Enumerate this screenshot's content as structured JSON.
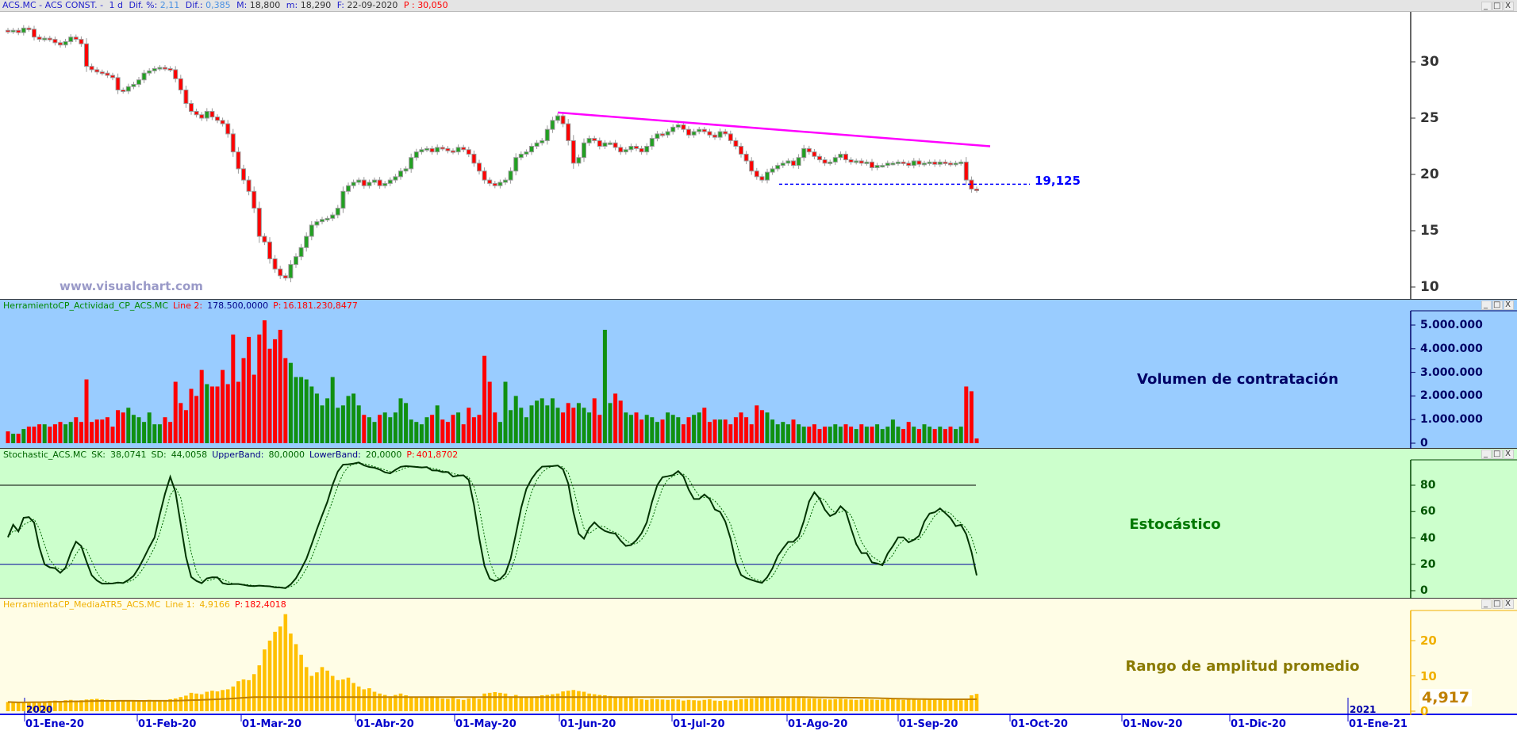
{
  "title_bar": {
    "symbol": "ACS.MC - ACS CONST. -",
    "period": "1 d",
    "dif_pct_label": "Dif. %:",
    "dif_pct": "2,11",
    "dif_label": "Dif.:",
    "dif": "0,385",
    "max_label": "M:",
    "max": "18,800",
    "min_label": "m:",
    "min": "18,290",
    "date_label": "F:",
    "date": "22-09-2020",
    "p_label": "P :",
    "p": "30,050"
  },
  "window_buttons": {
    "minimize": "_",
    "maximize": "□",
    "close": "X"
  },
  "watermark": "www.visualchart.com",
  "panels": {
    "price": {
      "support_label": "19,125",
      "trendline_color": "#ff00ff",
      "support_color": "#0000ff"
    },
    "volume": {
      "name": "HerramientoCP_Actividad_CP_ACS.MC",
      "line_label": "Line 2:",
      "line_value": "178.500,0000",
      "p_label": "P:",
      "p_value": "16.181.230,8477",
      "caption": "Volumen de contratación",
      "bg": "#99ccff"
    },
    "stochastic": {
      "name": "Stochastic_ACS.MC",
      "sk_label": "SK:",
      "sk": "38,0741",
      "sd_label": "SD:",
      "sd": "44,0058",
      "ub_label": "UpperBand:",
      "ub": "80,0000",
      "lb_label": "LowerBand:",
      "lb": "20,0000",
      "p_label": "P:",
      "p_value": "401,8702",
      "caption": "Estocástico",
      "bg": "#ccffcc"
    },
    "atr": {
      "name": "HerramientaCP_MediaATR5_ACS.MC",
      "line_label": "Line 1:",
      "line_value": "4,9166",
      "p_label": "P:",
      "p_value": "182,4018",
      "caption": "Rango de amplitud promedio",
      "last_value": "4,917",
      "bg": "#fffde6"
    }
  },
  "axes": {
    "price_ticks": [
      "30",
      "25",
      "20",
      "15",
      "10"
    ],
    "volume_ticks": [
      "5.000.000",
      "4.000.000",
      "3.000.000",
      "2.000.000",
      "1.000.000",
      "0"
    ],
    "stoch_ticks": [
      "80",
      "60",
      "40",
      "20",
      "0"
    ],
    "atr_ticks": [
      "20",
      "10",
      "0"
    ],
    "date_ticks": [
      "01-Ene-20",
      "01-Feb-20",
      "01-Mar-20",
      "01-Abr-20",
      "01-May-20",
      "01-Jun-20",
      "01-Jul-20",
      "01-Ago-20",
      "01-Sep-20",
      "01-Oct-20",
      "01-Nov-20",
      "01-Dic-20",
      "01-Ene-21"
    ],
    "year_labels": [
      "2020",
      "2021"
    ]
  },
  "chart_data": {
    "type": "candlestick",
    "price_ylim": [
      9,
      34
    ],
    "close": [
      32.7,
      32.8,
      32.6,
      33.0,
      32.9,
      32.2,
      32.0,
      32.1,
      32.0,
      31.7,
      31.5,
      31.8,
      32.2,
      32.0,
      31.6,
      29.6,
      29.3,
      29.1,
      29.0,
      28.8,
      28.6,
      27.5,
      27.4,
      27.8,
      28.0,
      28.4,
      29.0,
      29.2,
      29.4,
      29.5,
      29.4,
      29.3,
      28.5,
      27.5,
      26.3,
      25.6,
      25.3,
      25.0,
      25.6,
      25.1,
      24.8,
      24.5,
      23.6,
      22.0,
      20.5,
      19.5,
      18.5,
      17.0,
      14.5,
      14.0,
      12.5,
      11.6,
      11.0,
      10.8,
      12.0,
      12.7,
      13.5,
      14.5,
      15.5,
      15.8,
      16.0,
      16.1,
      16.4,
      17.0,
      18.5,
      19.0,
      19.3,
      19.5,
      19.0,
      19.3,
      19.5,
      19.0,
      19.2,
      19.5,
      19.8,
      20.3,
      20.5,
      21.5,
      22.0,
      22.2,
      22.3,
      22.0,
      22.4,
      22.3,
      22.1,
      22.0,
      22.4,
      22.2,
      21.8,
      21.0,
      20.3,
      19.5,
      19.2,
      19.0,
      19.3,
      19.5,
      20.3,
      21.5,
      21.8,
      22.0,
      22.5,
      22.8,
      23.0,
      24.0,
      24.8,
      25.2,
      24.5,
      23.0,
      21.0,
      21.5,
      22.8,
      23.2,
      23.0,
      22.5,
      22.8,
      22.8,
      22.4,
      22.0,
      22.2,
      22.5,
      22.3,
      22.0,
      22.5,
      23.2,
      23.6,
      23.5,
      23.8,
      24.2,
      24.4,
      24.0,
      23.5,
      23.8,
      24.0,
      23.8,
      23.5,
      23.3,
      23.8,
      23.6,
      23.0,
      22.5,
      21.8,
      21.2,
      20.3,
      19.8,
      19.5,
      20.2,
      20.5,
      20.8,
      21.0,
      21.2,
      20.8,
      21.5,
      22.3,
      22.0,
      21.6,
      21.3,
      21.0,
      21.1,
      21.5,
      21.8,
      21.3,
      21.1,
      21.2,
      21.0,
      21.1,
      20.6,
      20.8,
      20.8,
      21.0,
      21.0,
      21.1,
      21.0,
      20.8,
      21.2,
      20.9,
      21.0,
      21.1,
      20.9,
      21.1,
      21.0,
      20.9,
      21.0,
      21.1,
      19.5,
      18.7,
      18.6
    ],
    "volume_millions": [
      0.5,
      0.4,
      0.4,
      0.6,
      0.7,
      0.7,
      0.8,
      0.8,
      0.7,
      0.8,
      0.9,
      0.8,
      0.9,
      1.1,
      0.9,
      2.7,
      0.9,
      1.0,
      1.0,
      1.1,
      0.7,
      1.4,
      1.3,
      1.5,
      1.2,
      1.1,
      0.9,
      1.3,
      0.8,
      0.8,
      1.1,
      0.9,
      2.6,
      1.7,
      1.4,
      2.3,
      2.0,
      3.1,
      2.5,
      2.4,
      2.4,
      3.1,
      2.5,
      4.6,
      2.6,
      3.6,
      4.5,
      2.9,
      4.6,
      5.2,
      4.0,
      4.4,
      4.8,
      3.6,
      3.4,
      2.8,
      2.8,
      2.7,
      2.4,
      2.1,
      1.6,
      1.9,
      2.8,
      1.5,
      1.6,
      2.0,
      2.1,
      1.6,
      1.2,
      1.1,
      0.9,
      1.2,
      1.3,
      1.1,
      1.3,
      1.9,
      1.7,
      1.0,
      0.9,
      0.8,
      1.1,
      1.2,
      1.6,
      1.0,
      0.9,
      1.2,
      1.3,
      0.8,
      1.5,
      1.1,
      1.2,
      3.7,
      2.6,
      1.3,
      0.9,
      2.6,
      1.4,
      2.0,
      1.5,
      1.1,
      1.6,
      1.8,
      1.9,
      1.6,
      1.9,
      1.5,
      1.3,
      1.7,
      1.5,
      1.7,
      1.5,
      1.3,
      1.9,
      1.2,
      4.8,
      1.7,
      2.1,
      1.8,
      1.3,
      1.2,
      1.3,
      1.0,
      1.2,
      1.1,
      0.9,
      1.0,
      1.3,
      1.2,
      1.1,
      0.8,
      1.1,
      1.2,
      1.3,
      1.5,
      0.9,
      1.0,
      1.0,
      1.0,
      0.8,
      1.1,
      1.3,
      1.1,
      0.8,
      1.6,
      1.4,
      1.3,
      1.0,
      0.8,
      0.9,
      0.8,
      1.0,
      0.8,
      0.7,
      0.7,
      0.8,
      0.6,
      0.7,
      0.7,
      0.8,
      0.7,
      0.8,
      0.7,
      0.6,
      0.8,
      0.7,
      0.7,
      0.8,
      0.6,
      0.7,
      1.0,
      0.7,
      0.6,
      0.9,
      0.7,
      0.6,
      0.8,
      0.7,
      0.6,
      0.7,
      0.6,
      0.7,
      0.6,
      0.7,
      2.4,
      2.2,
      0.2
    ],
    "volume_ylim": [
      0,
      5.3
    ],
    "atr": [
      2.6,
      2.5,
      2.4,
      2.5,
      2.6,
      2.7,
      2.6,
      2.8,
      2.9,
      3.0,
      2.9,
      3.1,
      3.2,
      3.0,
      3.1,
      3.3,
      3.4,
      3.5,
      3.3,
      3.2,
      3.0,
      3.1,
      3.0,
      2.9,
      2.8,
      2.7,
      3.0,
      3.2,
      3.0,
      2.9,
      3.1,
      3.4,
      3.6,
      4.0,
      4.4,
      5.2,
      5.0,
      4.8,
      5.5,
      5.8,
      5.6,
      6.0,
      6.2,
      7.0,
      8.5,
      9.0,
      8.8,
      10.5,
      13.0,
      17.5,
      20.0,
      22.5,
      24.0,
      27.5,
      22.0,
      19.0,
      16.0,
      12.5,
      10.0,
      11.0,
      12.5,
      11.5,
      10.0,
      8.8,
      9.0,
      9.5,
      8.0,
      7.0,
      6.2,
      6.5,
      5.5,
      5.0,
      4.6,
      4.2,
      4.6,
      5.0,
      4.5,
      4.0,
      3.8,
      3.7,
      4.0,
      4.2,
      3.8,
      3.6,
      3.5,
      3.8,
      3.4,
      3.2,
      3.6,
      3.9,
      3.5,
      5.0,
      5.2,
      5.4,
      5.2,
      5.0,
      4.2,
      4.6,
      4.0,
      3.9,
      4.1,
      4.2,
      4.5,
      4.6,
      4.8,
      5.0,
      5.6,
      5.8,
      6.0,
      5.7,
      5.5,
      5.0,
      4.8,
      4.6,
      4.5,
      4.3,
      4.0,
      3.8,
      4.0,
      3.9,
      3.6,
      3.4,
      3.2,
      3.5,
      3.4,
      3.3,
      3.2,
      3.4,
      3.3,
      3.0,
      3.2,
      3.1,
      3.0,
      3.2,
      3.4,
      3.0,
      2.9,
      3.1,
      3.0,
      3.2,
      3.4,
      3.5,
      3.6,
      3.7,
      3.8,
      3.8,
      3.7,
      3.6,
      3.8,
      3.9,
      3.7,
      3.8,
      3.7,
      3.6,
      3.6,
      3.5,
      3.4,
      3.3,
      3.4,
      3.5,
      3.4,
      3.3,
      3.2,
      3.3,
      3.4,
      3.3,
      3.2,
      3.3,
      3.4,
      3.4,
      3.3,
      3.2,
      3.3,
      3.3,
      3.2,
      3.4,
      3.3,
      3.2,
      3.3,
      3.2,
      3.3,
      3.2,
      3.1,
      3.4,
      4.5,
      4.9
    ],
    "atr_ylim": [
      0,
      28
    ],
    "stoch_ylim": [
      -5,
      100
    ],
    "stoch_bands": [
      80,
      20
    ],
    "support_level": 19.125,
    "trendline": {
      "from": 25.5,
      "to": 22.5
    },
    "colors": {
      "up": "#22a022",
      "down": "#ff0000",
      "sk": "#003300",
      "atr_bar": "#ffc000",
      "atr_avg": "#c08000"
    }
  }
}
